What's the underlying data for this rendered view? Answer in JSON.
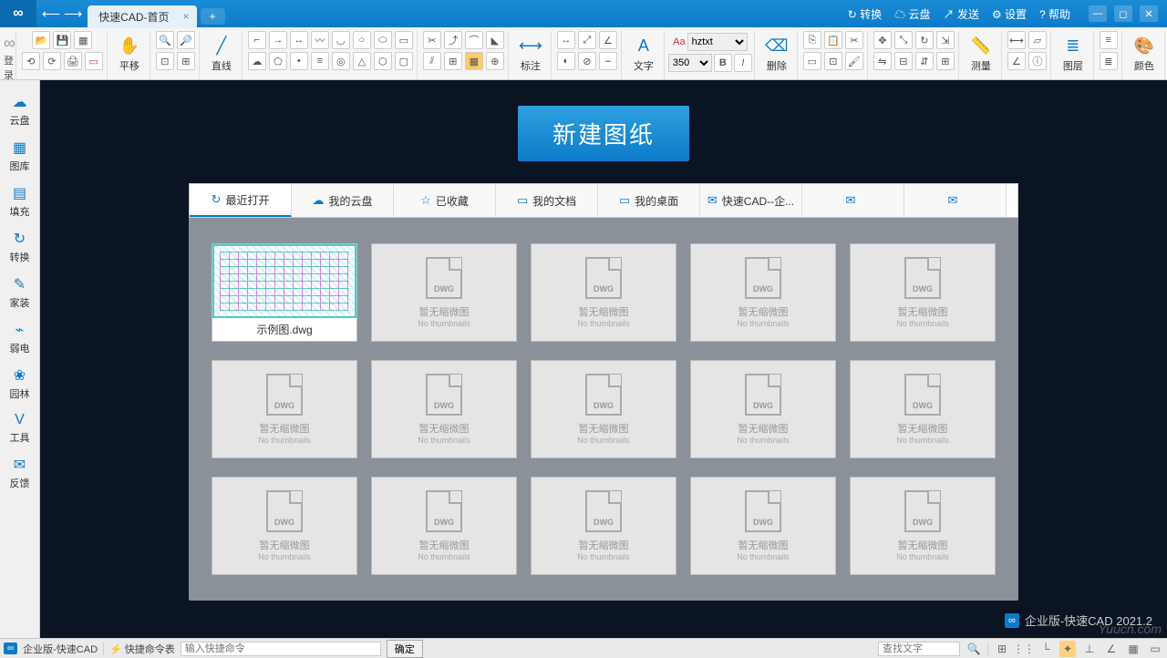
{
  "title": "快速CAD-首页",
  "login_label": "登录",
  "top_actions": {
    "convert": "转换",
    "cloud": "云盘",
    "send": "发送",
    "settings": "设置",
    "help": "帮助"
  },
  "ribbon": {
    "pan_label": "平移",
    "line_label": "直线",
    "annotate_label": "标注",
    "text_label": "文字",
    "font_name": "hztxt",
    "font_size": "350",
    "delete_label": "删除",
    "measure_label": "测量",
    "layer_label": "图层",
    "color_label": "颜色"
  },
  "sidebar": {
    "items": [
      {
        "icon": "☁",
        "label": "云盘"
      },
      {
        "icon": "▦",
        "label": "图库"
      },
      {
        "icon": "▤",
        "label": "填充"
      },
      {
        "icon": "↻",
        "label": "转换"
      },
      {
        "icon": "✎",
        "label": "家装"
      },
      {
        "icon": "⌁",
        "label": "弱电"
      },
      {
        "icon": "❀",
        "label": "园林"
      },
      {
        "icon": "V",
        "label": "工具"
      },
      {
        "icon": "✉",
        "label": "反馈"
      }
    ]
  },
  "canvas": {
    "new_drawing": "新建图纸",
    "tabs": [
      {
        "icon": "↻",
        "label": "最近打开",
        "active": true
      },
      {
        "icon": "☁",
        "label": "我的云盘"
      },
      {
        "icon": "☆",
        "label": "已收藏"
      },
      {
        "icon": "▭",
        "label": "我的文档"
      },
      {
        "icon": "▭",
        "label": "我的桌面"
      },
      {
        "icon": "✉",
        "label": "快速CAD--企..."
      },
      {
        "icon": "✉",
        "label": ""
      },
      {
        "icon": "✉",
        "label": ""
      }
    ],
    "sample_file": "示例图.dwg",
    "nothumb_cn": "暂无缩微图",
    "nothumb_en": "No thumbnails",
    "version_label": "企业版-快速CAD 2021.2",
    "watermark": "Yuucn.com"
  },
  "statusbar": {
    "edition": "企业版-快速CAD",
    "quick_cmd_label": "快捷命令表",
    "cmd_placeholder": "输入快捷命令",
    "confirm": "确定",
    "search_placeholder": "查找文字"
  },
  "colors": {
    "row1": [
      "#ffffff",
      "#ff0000",
      "#ffff00",
      "#00ff00"
    ],
    "row2": [
      "#000000",
      "#00ffff",
      "#0000ff",
      "#ff00ff"
    ]
  }
}
